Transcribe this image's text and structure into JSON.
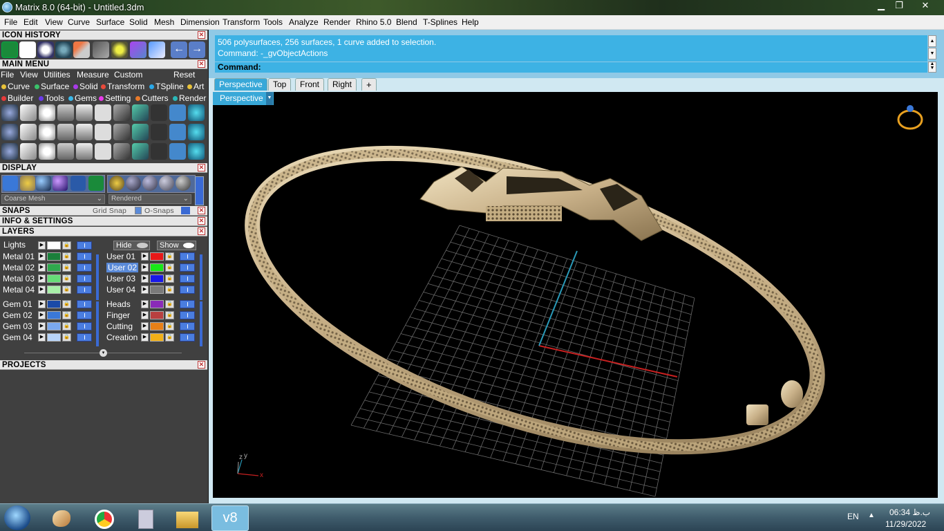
{
  "window": {
    "title": "Matrix 8.0 (64-bit) - Untitled.3dm"
  },
  "menubar": [
    "File",
    "Edit",
    "View",
    "Curve",
    "Surface",
    "Solid",
    "Mesh",
    "Dimension",
    "Transform",
    "Tools",
    "Analyze",
    "Render",
    "Blend",
    "Rhino 5.0",
    "T-Splines",
    "Help"
  ],
  "panels": {
    "icon_history": "ICON HISTORY",
    "main_menu": "MAIN MENU",
    "display": "DISPLAY",
    "snaps": "SNAPS",
    "info": "INFO & SETTINGS",
    "layers": "LAYERS",
    "projects": "PROJECTS"
  },
  "main_menu_items": [
    "File",
    "View",
    "Utilities",
    "Measure",
    "Custom"
  ],
  "main_menu_reset": "Reset",
  "categories_row1": [
    "Curve",
    "Surface",
    "Solid",
    "Transform",
    "TSpline",
    "Art"
  ],
  "categories_row2": [
    "Builder",
    "Tools",
    "Gems",
    "Setting",
    "Cutters",
    "Render"
  ],
  "display": {
    "mesh_combo": "Coarse Mesh",
    "render_combo": "Rendered"
  },
  "snaps": {
    "grid_snap": "Grid Snap",
    "o_snaps": "O-Snaps"
  },
  "layers": {
    "lights": "Lights",
    "hide": "Hide",
    "show": "Show",
    "left": [
      {
        "name": "Metal 01",
        "color": "#1a7f3a"
      },
      {
        "name": "Metal 02",
        "color": "#2fa84d"
      },
      {
        "name": "Metal 03",
        "color": "#66dd77"
      },
      {
        "name": "Metal 04",
        "color": "#a8f0a8"
      },
      {
        "name": "Gem 01",
        "color": "#1a4aa8"
      },
      {
        "name": "Gem 02",
        "color": "#3a78d8"
      },
      {
        "name": "Gem 03",
        "color": "#7aa8ee"
      },
      {
        "name": "Gem 04",
        "color": "#b8d4f8"
      }
    ],
    "right": [
      {
        "name": "User 01",
        "color": "#e81818"
      },
      {
        "name": "User 02",
        "color": "#18e818"
      },
      {
        "name": "User 03",
        "color": "#1818e8"
      },
      {
        "name": "User 04",
        "color": "#7a7a7a"
      },
      {
        "name": "Heads",
        "color": "#8a2ab8"
      },
      {
        "name": "Finger",
        "color": "#b84040"
      },
      {
        "name": "Cutting",
        "color": "#e88018"
      },
      {
        "name": "Creation",
        "color": "#f0b018"
      }
    ]
  },
  "command": {
    "line1": "506 polysurfaces, 256 surfaces, 1 curve added to selection.",
    "line2": "Command: -_gvObjectActions",
    "prompt": "Command:"
  },
  "tabs": [
    "Perspective",
    "Top",
    "Front",
    "Right",
    "+"
  ],
  "viewport": {
    "label": "Perspective",
    "axis_z": "z",
    "axis_y": "y",
    "axis_x": "x"
  },
  "taskbar": {
    "lang": "EN",
    "time": "06:34 ب.ظ",
    "date": "11/29/2022",
    "active_app": "v8"
  }
}
